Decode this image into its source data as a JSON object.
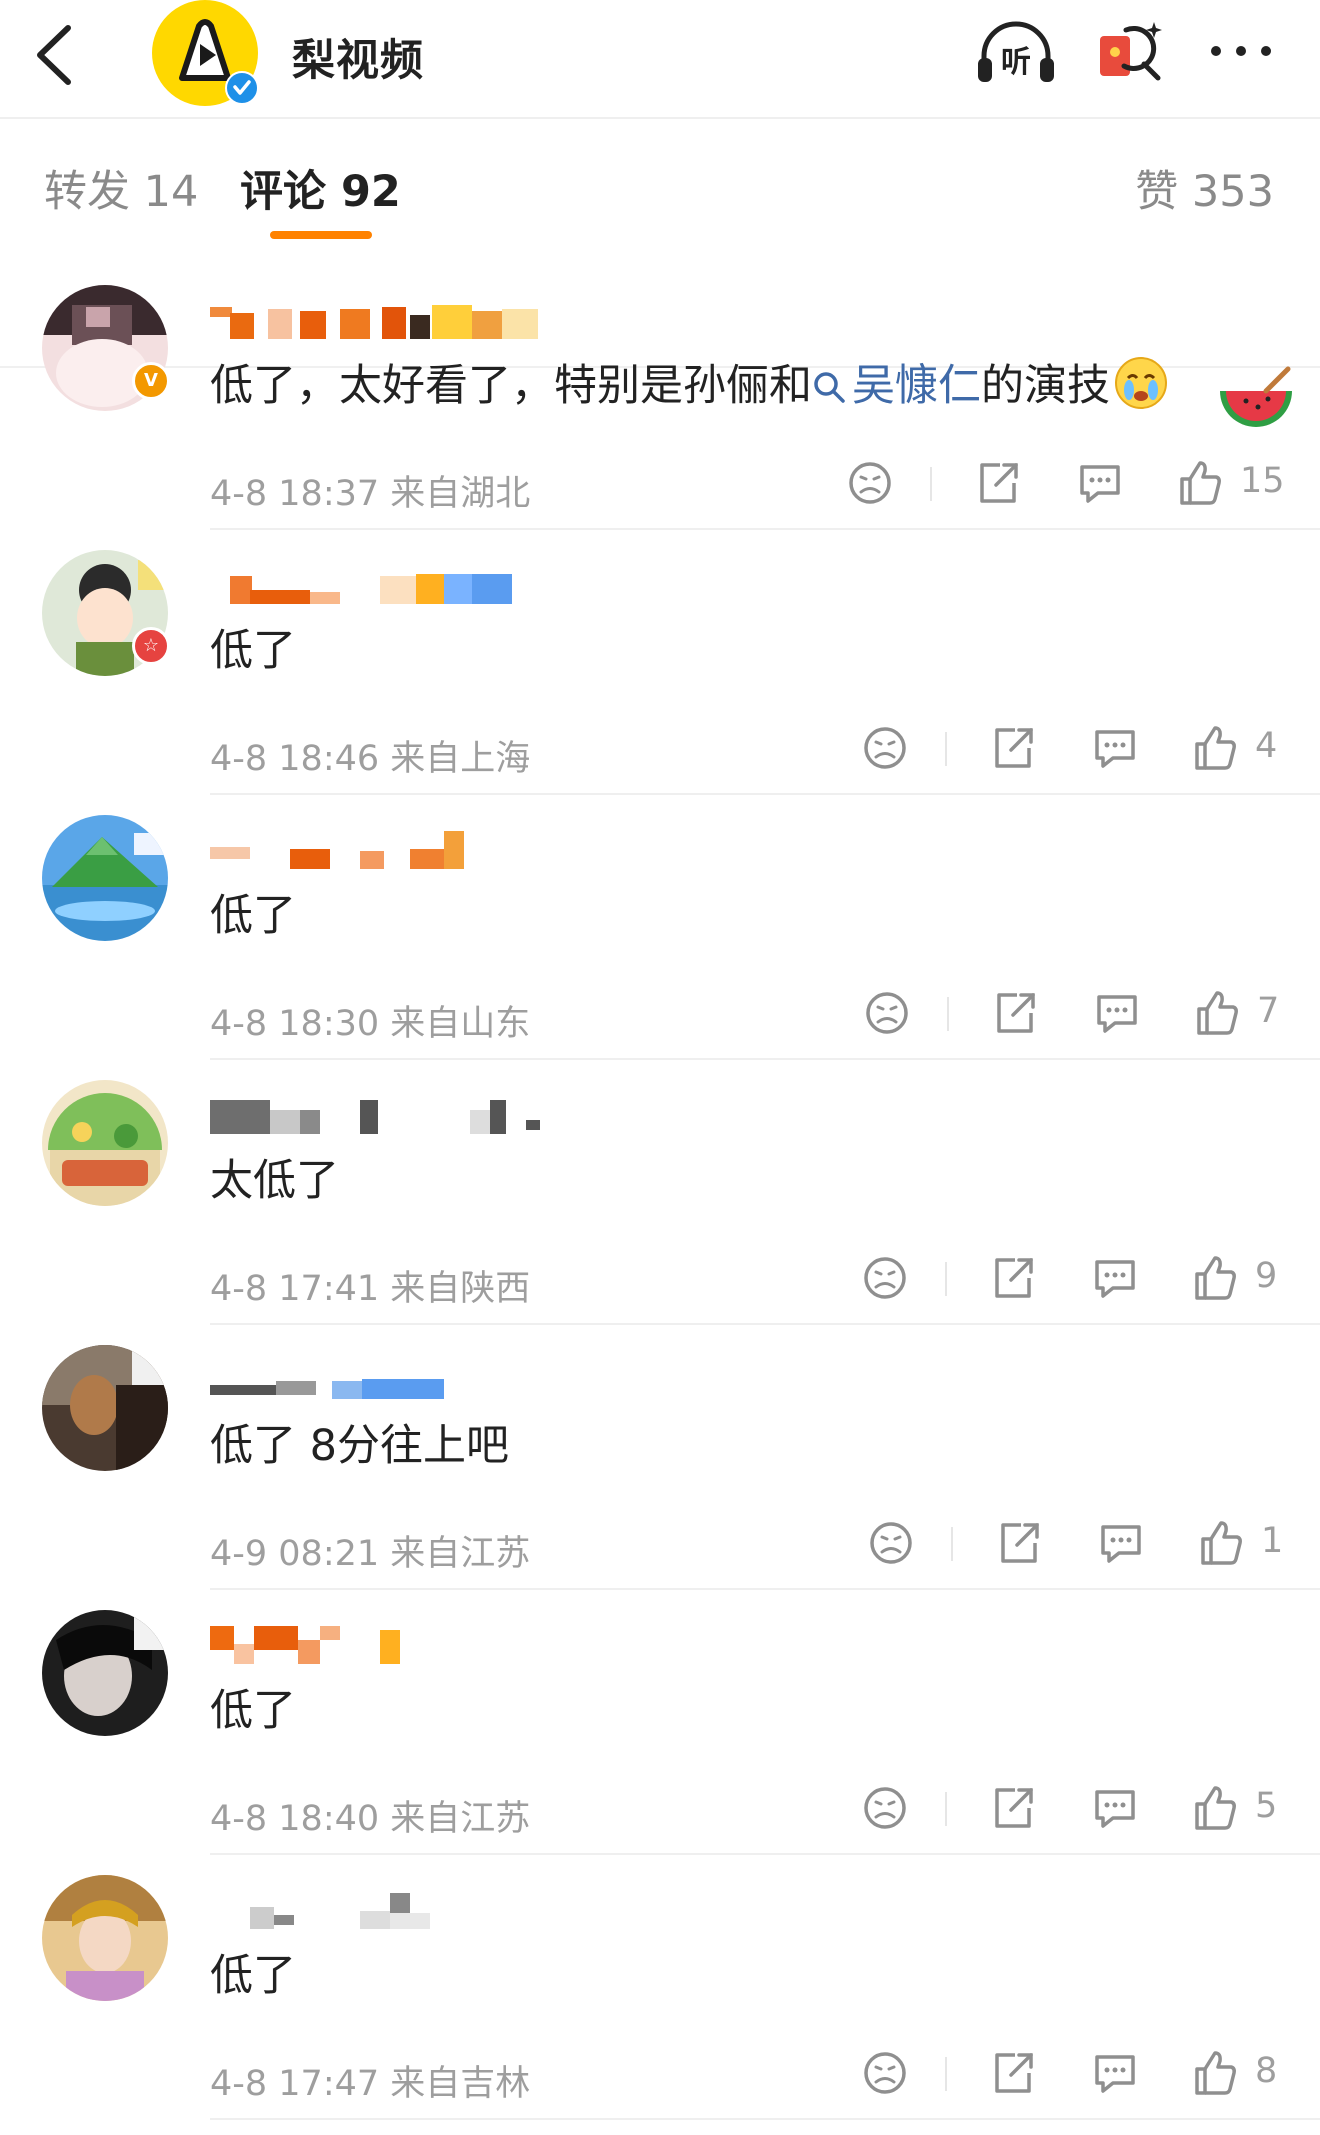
{
  "header": {
    "account_name": "梨视频",
    "icons": [
      "back-arrow-icon",
      "pear-video-logo",
      "verified-icon",
      "listen-icon",
      "red-packet-icon",
      "more-icon"
    ]
  },
  "tabs": {
    "reposts": "转发 14",
    "comments": "评论 92",
    "likes": "赞 353",
    "accent_color": "#ff8200"
  },
  "comments": [
    {
      "text_before": "低了，太好看了，特别是孙俪和",
      "topic": "吴慷仁",
      "text_after": "的演技",
      "meta": "4-8 18:37 来自湖北",
      "likes": "15",
      "badge": "V"
    },
    {
      "text": "低了",
      "meta": "4-8 18:46 来自上海",
      "likes": "4",
      "badge": "☆"
    },
    {
      "text": "低了",
      "meta": "4-8 18:30 来自山东",
      "likes": "7"
    },
    {
      "text": "太低了",
      "meta": "4-8 17:41 来自陕西",
      "likes": "9"
    },
    {
      "text": "低了 8分往上吧",
      "meta": "4-9 08:21 来自江苏",
      "likes": "1"
    },
    {
      "text": "低了",
      "meta": "4-8 18:40 来自江苏",
      "likes": "5"
    },
    {
      "text": "低了",
      "meta": "4-8 17:47 来自吉林",
      "likes": "8"
    }
  ],
  "colors": {
    "link": "#3f6aa8",
    "meta_text": "#9e9e9e",
    "logo_yellow": "#ffd800",
    "verified_blue": "#1e90e8"
  }
}
